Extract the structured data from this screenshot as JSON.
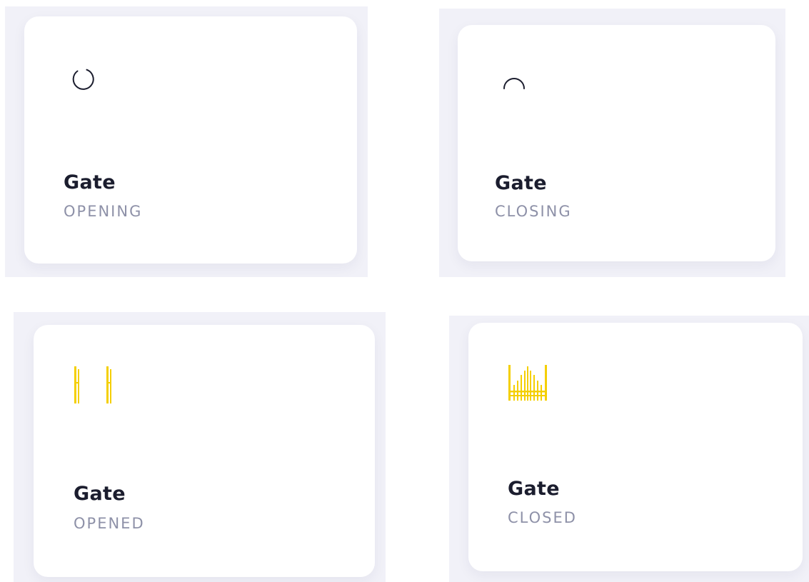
{
  "accent_color": "#f4cf00",
  "cards": [
    {
      "title": "Gate",
      "status": "OPENING",
      "icon": "spinner-icon"
    },
    {
      "title": "Gate",
      "status": "CLOSING",
      "icon": "spinner-icon"
    },
    {
      "title": "Gate",
      "status": "OPENED",
      "icon": "gate-opened-icon"
    },
    {
      "title": "Gate",
      "status": "CLOSED",
      "icon": "gate-closed-icon"
    }
  ]
}
